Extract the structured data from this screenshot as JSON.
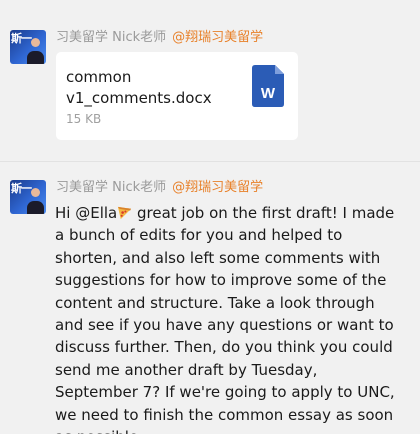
{
  "messages": [
    {
      "sender_name": "习美留学 Nick老师",
      "sender_org": "@翔瑞习美留学",
      "avatar_text": "斯一",
      "file": {
        "name": "common v1_comments.docx",
        "size": "15 KB",
        "icon": "word-doc-icon",
        "icon_letter": "W",
        "icon_color": "#2b5cb6"
      }
    },
    {
      "sender_name": "习美留学 Nick老师",
      "sender_org": "@翔瑞习美留学",
      "avatar_text": "斯一",
      "text_before_emoji": "Hi @Ella",
      "emoji": "pizza-icon",
      "text_after_emoji": " great job on the first draft! I made a bunch of edits for you and helped to shorten, and also left some comments with suggestions for how to improve some of the content and structure. Take a look through and see if you have any questions or want to discuss further. Then, do you think you could send me another draft by Tuesday, September 7? If we're going to apply to UNC, we need to finish the common essay as soon as possible~"
    }
  ],
  "colors": {
    "background": "#f1f1f1",
    "sender_name": "#9a9a9a",
    "sender_org": "#e8812a",
    "card": "#ffffff"
  }
}
